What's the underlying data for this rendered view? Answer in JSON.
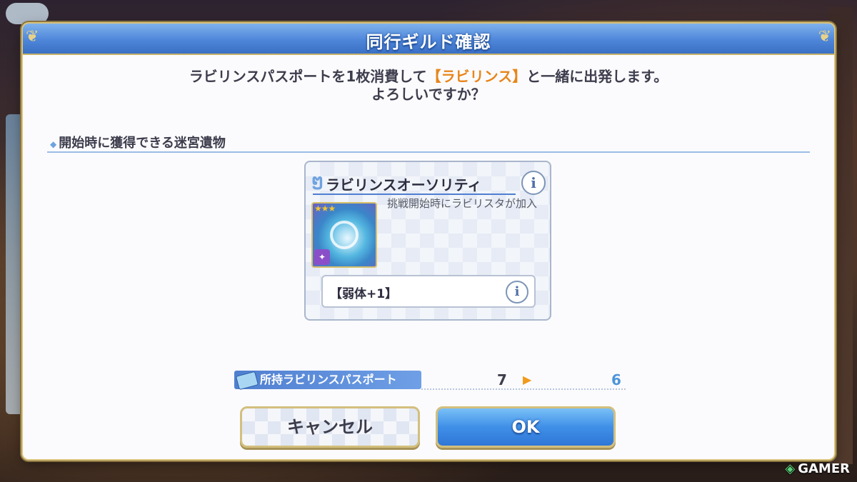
{
  "dialog": {
    "title": "同行ギルド確認",
    "message_part1": "ラビリンスパスポートを1枚消費して",
    "message_highlight": "【ラビリンス】",
    "message_part2": "と一緒に出発します。",
    "message_line2": "よろしいですか？"
  },
  "section": {
    "title": "開始時に獲得できる迷宮遺物"
  },
  "relic": {
    "name": "ラビリンスオーソリティ",
    "description": "挑戦開始時にラビリスタが加入",
    "stars": "★★★",
    "effect": "【弱体+1】",
    "icon": "labyrinth-map-icon"
  },
  "passport": {
    "label": "所持ラビリンスパスポート",
    "before": "7",
    "after": "6"
  },
  "buttons": {
    "cancel": "キャンセル",
    "ok": "OK"
  },
  "watermark": {
    "text": "GAMER"
  },
  "colors": {
    "header_blue": "#4e86da",
    "highlight_orange": "#e8851a",
    "count_after_blue": "#4e95d8",
    "gold_border": "#d3bf7e"
  }
}
